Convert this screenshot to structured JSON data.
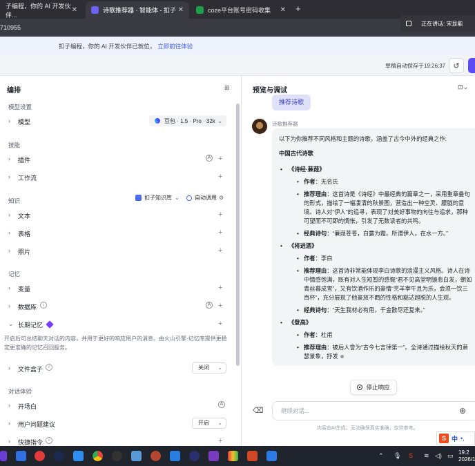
{
  "browser": {
    "tabs": [
      {
        "label": "子编程，你的 AI 开发伙伴...",
        "active": false
      },
      {
        "label": "诗歌推荐器 · 智能体 - 扣子",
        "active": true
      },
      {
        "label": "coze平台账号密码收集",
        "active": false
      }
    ],
    "url_fragment": "710955",
    "speaking_label": "正在讲话: 宋显能"
  },
  "banner": {
    "text": "扣子编程，你的 AI 开发伙伴已就位，",
    "link": "立即前往体验"
  },
  "toolbar": {
    "autosave": "草稿自动保存于19:26:37"
  },
  "left_panel": {
    "title": "编排",
    "model_section": "模型设置",
    "model_label": "模型",
    "model_value": "豆包 · 1.5 · Pro · 32k",
    "skills_section": "技能",
    "plugin_label": "插件",
    "workflow_label": "工作流",
    "knowledge_section": "知识",
    "kb_selector": "扣子知识库",
    "auto_call": "自动调用",
    "text_label": "文本",
    "table_label": "表格",
    "photo_label": "照片",
    "memory_section": "记忆",
    "variable_label": "变量",
    "database_label": "数据库",
    "longmem_label": "长期记忆",
    "longmem_desc": "开启后可总结聊天对话的内容，并用于更好的响应用户的消息。由火山引擎·记忆库提供更稳定更准确的记忆召回服务。",
    "filebox_label": "文件盒子",
    "filebox_value": "关闭",
    "chat_section": "对话体验",
    "opener_label": "开场白",
    "suggest_label": "用户问题建议",
    "suggest_value": "开启",
    "shortcut_label": "快捷指令"
  },
  "right_panel": {
    "title": "预览与调试",
    "user_msg": "推荐诗歌",
    "bot_name": "诗歌推荐器",
    "intro": "以下为你推荐不同风格和主题的诗歌，涵盖了古今中外的经典之作:",
    "heading": "中国古代诗歌",
    "poems": [
      {
        "title": "《诗经·蒹葭》",
        "author_label": "作者",
        "author": "无名氏",
        "reason_label": "推荐理由",
        "reason": "这首诗是《诗经》中最经典的篇章之一，采用重章叠句的形式，描绘了一幅凄清的秋景图，营造出一种空灵、朦胧的意境。诗人对“伊人”的追寻，表现了对美好事物的向往与追求，那种可望而不可即的惆怅，引发了无数读者的共鸣。",
        "verse_label": "经典诗句",
        "verse": "“蒹葭苍苍，白露为霜。所谓伊人，在水一方。”"
      },
      {
        "title": "《将进酒》",
        "author_label": "作者",
        "author": "李白",
        "reason_label": "推荐理由",
        "reason": "这首诗非常能体现李白诗歌的浪漫主义风格。诗人在诗中情感饱满，既有对人生短暂的感慨“君不见高堂明镜悲白发，朝如青丝暮成雪”，又有饮酒作乐的豪情“烹羊宰牛且为乐，会须一饮三百杯”，充分展现了他豪放不羁的性格和豁达超脱的人生观。",
        "verse_label": "经典诗句",
        "verse": "“天生我材必有用，千金散尽还复来。”"
      },
      {
        "title": "《登高》",
        "author_label": "作者",
        "author": "杜甫",
        "reason_label": "推荐理由",
        "reason": "被后人誉为“古今七言律第一”。全诗通过描绘秋天的萧瑟景象，抒发"
      }
    ],
    "stop_label": "停止响应",
    "input_placeholder": "继续对话...",
    "disclaimer": "内容由AI生成，无法确保真实准确，仅供参考。"
  },
  "taskbar": {
    "time": "19:2",
    "date": "2026/1"
  },
  "colors": {
    "accent": "#5a4bf2",
    "link": "#3d5cf0",
    "bubble": "#dfe1fb"
  }
}
